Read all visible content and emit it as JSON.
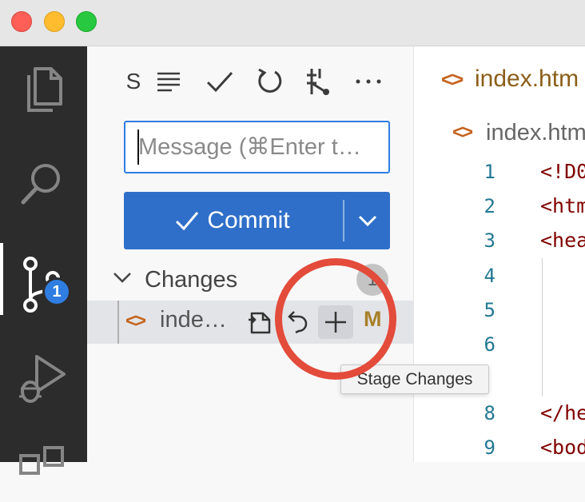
{
  "window": {
    "traffic_lights": [
      "close",
      "minimize",
      "maximize"
    ]
  },
  "activity_bar": {
    "items": [
      {
        "icon": "files-icon"
      },
      {
        "icon": "search-icon"
      },
      {
        "icon": "source-control-icon",
        "active": true,
        "badge": "1"
      },
      {
        "icon": "run-debug-icon"
      },
      {
        "icon": "extensions-icon"
      }
    ]
  },
  "scm": {
    "toolbar": {
      "s_label": "S",
      "icons": [
        "list-icon",
        "check-icon",
        "refresh-icon",
        "graph-icon",
        "more-icon"
      ]
    },
    "message_placeholder": "Message (⌘Enter t…",
    "commit_label": "Commit",
    "changes": {
      "label": "Changes",
      "count": "1",
      "files": [
        {
          "name": "inde…",
          "status": "M"
        }
      ]
    },
    "tooltip": "Stage Changes"
  },
  "editor": {
    "tab_title": "index.htm",
    "breadcrumb": "index.htm",
    "lines": [
      {
        "no": "1",
        "code": "<!D0"
      },
      {
        "no": "2",
        "code": "<htm"
      },
      {
        "no": "3",
        "code": "<hea"
      },
      {
        "no": "4",
        "code": ""
      },
      {
        "no": "5",
        "code": ""
      },
      {
        "no": "6",
        "code": ""
      },
      {
        "no": "8",
        "code": "</he"
      },
      {
        "no": "9",
        "code": "<bod"
      }
    ]
  },
  "colors": {
    "accent": "#2f7de1",
    "commit_button": "#2f6fc9",
    "annotation": "#e34b3b",
    "modified": "#a8802a",
    "html_icon": "#c5641e"
  }
}
